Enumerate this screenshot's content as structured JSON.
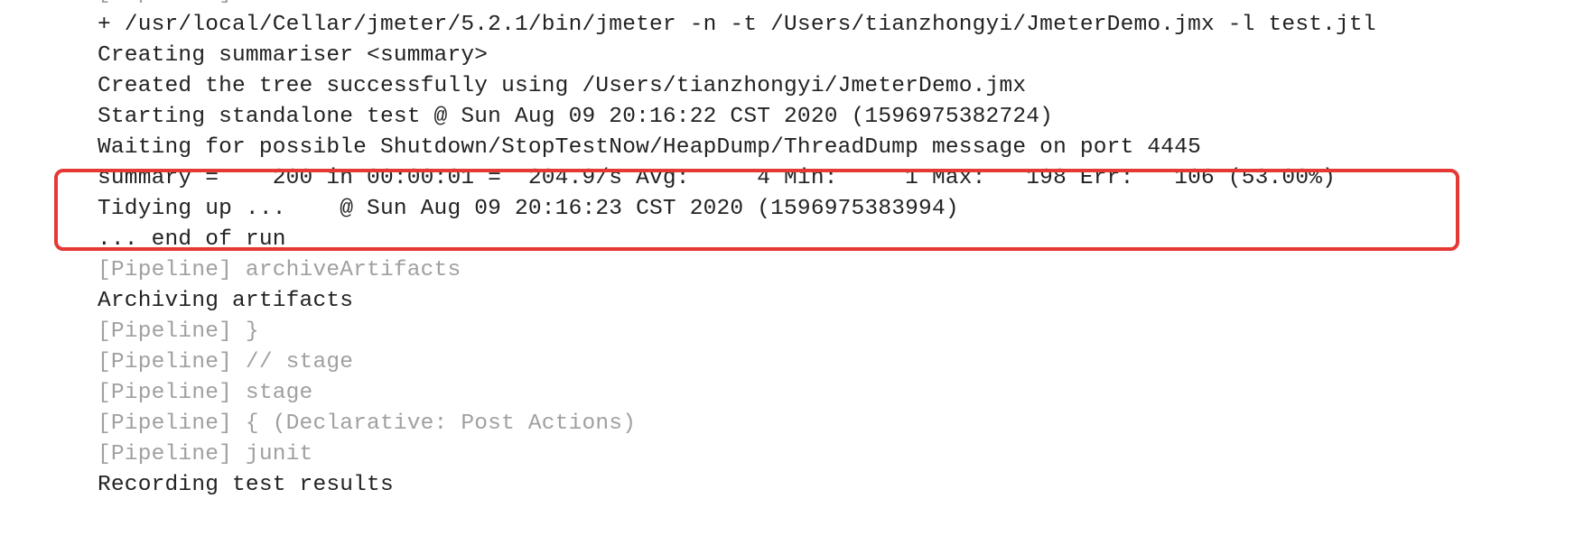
{
  "console": {
    "lines": [
      {
        "text": "[Pipeline] sh",
        "kind": "pipeline"
      },
      {
        "text": "+ /usr/local/Cellar/jmeter/5.2.1/bin/jmeter -n -t /Users/tianzhongyi/JmeterDemo.jmx -l test.jtl",
        "kind": "output"
      },
      {
        "text": "Creating summariser <summary>",
        "kind": "output"
      },
      {
        "text": "Created the tree successfully using /Users/tianzhongyi/JmeterDemo.jmx",
        "kind": "output"
      },
      {
        "text": "Starting standalone test @ Sun Aug 09 20:16:22 CST 2020 (1596975382724)",
        "kind": "output"
      },
      {
        "text": "Waiting for possible Shutdown/StopTestNow/HeapDump/ThreadDump message on port 4445",
        "kind": "output"
      },
      {
        "text": "summary =    200 in 00:00:01 =  204.9/s Avg:     4 Min:     1 Max:   198 Err:   106 (53.00%)",
        "kind": "output"
      },
      {
        "text": "Tidying up ...    @ Sun Aug 09 20:16:23 CST 2020 (1596975383994)",
        "kind": "output"
      },
      {
        "text": "... end of run",
        "kind": "output"
      },
      {
        "text": "[Pipeline] archiveArtifacts",
        "kind": "pipeline"
      },
      {
        "text": "Archiving artifacts",
        "kind": "output"
      },
      {
        "text": "[Pipeline] }",
        "kind": "pipeline"
      },
      {
        "text": "[Pipeline] // stage",
        "kind": "pipeline"
      },
      {
        "text": "[Pipeline] stage",
        "kind": "pipeline"
      },
      {
        "text": "[Pipeline] { (Declarative: Post Actions)",
        "kind": "pipeline"
      },
      {
        "text": "[Pipeline] junit",
        "kind": "pipeline"
      },
      {
        "text": "Recording test results",
        "kind": "output"
      }
    ]
  },
  "colors": {
    "highlight_border": "#e53935",
    "output_text": "#222222",
    "pipeline_text": "#a0a0a0",
    "background": "#ffffff"
  }
}
